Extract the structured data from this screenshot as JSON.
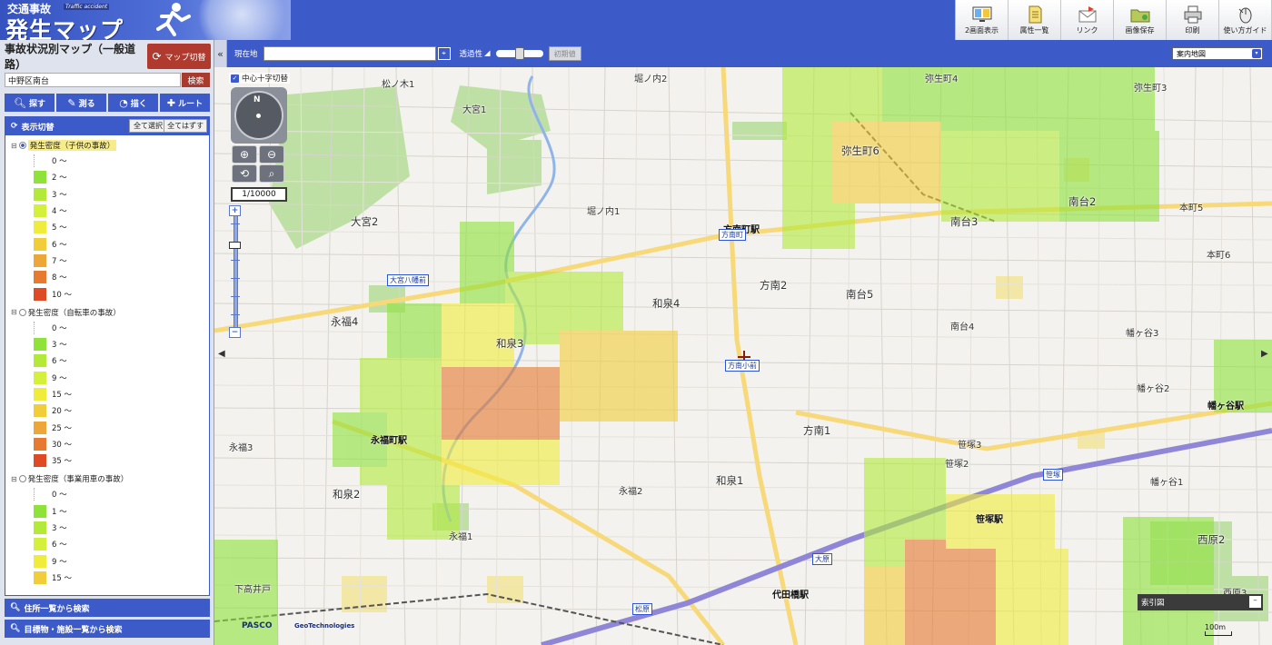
{
  "header": {
    "logo_line1": "交通事故",
    "logo_en": "Traffic accident",
    "logo_line2": "発生マップ",
    "tools": [
      {
        "label": "2画面表示",
        "icon": "dual-screen-icon"
      },
      {
        "label": "属性一覧",
        "icon": "document-list-icon"
      },
      {
        "label": "リンク",
        "icon": "link-envelope-icon"
      },
      {
        "label": "画像保存",
        "icon": "folder-save-icon"
      },
      {
        "label": "印刷",
        "icon": "printer-icon"
      },
      {
        "label": "使い方ガイド",
        "icon": "mouse-guide-icon"
      }
    ]
  },
  "panel": {
    "title": "事故状況別マップ（一般道路）",
    "map_switch": "マップ切替",
    "address_value": "中野区南台",
    "search_button": "検索",
    "nav": [
      "探す",
      "測る",
      "描く",
      "ルート"
    ],
    "layer_header": "表示切替",
    "select_all": "全て選択",
    "clear_all": "全てはずす",
    "groups": [
      {
        "name": "発生密度（子供の事故）",
        "active": true,
        "legend": [
          {
            "label": "0 ～",
            "color": ""
          },
          {
            "label": "2 ～",
            "color": "#8ee23a"
          },
          {
            "label": "3 ～",
            "color": "#b3ea3a"
          },
          {
            "label": "4 ～",
            "color": "#d4f03a"
          },
          {
            "label": "5 ～",
            "color": "#f0ec3c"
          },
          {
            "label": "6 ～",
            "color": "#f2cd3a"
          },
          {
            "label": "7 ～",
            "color": "#eda638"
          },
          {
            "label": "8 ～",
            "color": "#e67a30"
          },
          {
            "label": "10 ～",
            "color": "#dd4a24"
          }
        ]
      },
      {
        "name": "発生密度（自転車の事故）",
        "active": false,
        "legend": [
          {
            "label": "0 ～",
            "color": ""
          },
          {
            "label": "3 ～",
            "color": "#8ee23a"
          },
          {
            "label": "6 ～",
            "color": "#b3ea3a"
          },
          {
            "label": "9 ～",
            "color": "#d4f03a"
          },
          {
            "label": "15 ～",
            "color": "#f0ec3c"
          },
          {
            "label": "20 ～",
            "color": "#f2cd3a"
          },
          {
            "label": "25 ～",
            "color": "#eda638"
          },
          {
            "label": "30 ～",
            "color": "#e67a30"
          },
          {
            "label": "35 ～",
            "color": "#dd4a24"
          }
        ]
      },
      {
        "name": "発生密度（事業用車の事故）",
        "active": false,
        "legend": [
          {
            "label": "0 ～",
            "color": ""
          },
          {
            "label": "1 ～",
            "color": "#8ee23a"
          },
          {
            "label": "3 ～",
            "color": "#b3ea3a"
          },
          {
            "label": "6 ～",
            "color": "#d4f03a"
          },
          {
            "label": "9 ～",
            "color": "#f0ec3c"
          },
          {
            "label": "15 ～",
            "color": "#f2cd3a"
          }
        ]
      }
    ],
    "bottom1": "住所一覧から検索",
    "bottom2": "目標物・施設一覧から検索"
  },
  "maptoolbar": {
    "current_label": "現在地",
    "transparency_label": "透過性",
    "reset_label": "初期値",
    "map_type": "案内地図",
    "transparency_level": 0.5
  },
  "map": {
    "crosshair_label": "中心十字切替",
    "scale_label": "1/10000",
    "overview_label": "索引図",
    "scale_bar": "100m",
    "credit1": "PASCO",
    "credit2": "GeoTechnologies",
    "places": [
      "堀ノ内2",
      "松ノ木1",
      "大宮1",
      "弥生町4",
      "弥生町3",
      "弥生町6",
      "本町5",
      "南台3",
      "南台2",
      "本町6",
      "堀ノ内1",
      "大宮2",
      "和泉3",
      "和泉4",
      "方南2",
      "南台5",
      "南台4",
      "永福4",
      "幡ヶ谷3",
      "方南1",
      "永福町駅",
      "永福3",
      "和泉1",
      "笹塚3",
      "和泉2",
      "幡ヶ谷2",
      "永福2",
      "笹塚2",
      "幡ヶ谷1",
      "永福1",
      "方南町駅",
      "西原2",
      "代田橋駅",
      "笹塚駅",
      "幡ヶ谷駅",
      "下高井戸",
      "方南小前",
      "方南町",
      "大宮八幡前",
      "笹塚",
      "大原",
      "西原3",
      "松原"
    ]
  }
}
